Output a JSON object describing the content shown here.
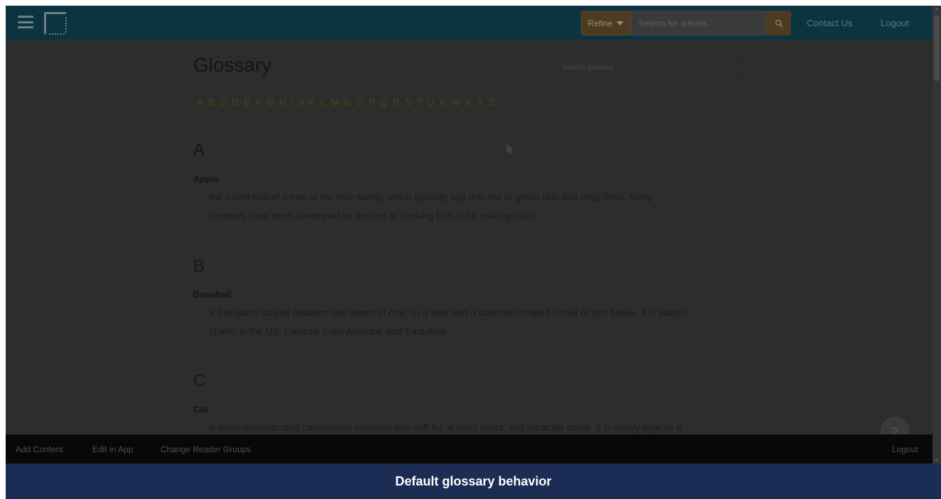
{
  "topnav": {
    "refine_label": "Refine",
    "search_placeholder": "Search for articles...",
    "contact_label": "Contact Us",
    "logout_label": "Logout"
  },
  "page": {
    "title": "Glossary",
    "search_placeholder": "Search glossary",
    "alphabet": [
      "A",
      "B",
      "C",
      "D",
      "E",
      "F",
      "G",
      "H",
      "I",
      "J",
      "K",
      "L",
      "M",
      "N",
      "O",
      "P",
      "Q",
      "R",
      "S",
      "T",
      "U",
      "V",
      "W",
      "X",
      "Y",
      "Z"
    ]
  },
  "sections": [
    {
      "letter": "A",
      "term": "Apple",
      "definition_line1": "the round fruit of a tree of the rose family, which typically has thin red or green skin and crisp flesh. Many",
      "definition_line2": "varieties have been developed as dessert or cooking fruit or for making cider."
    },
    {
      "letter": "B",
      "term": "Baseball",
      "definition_line1": "a ball game played between two teams of nine on a field with a diamond-shaped circuit of four bases. It is played",
      "definition_line2": "chiefly in the US, Canada, Latin America, and East Asia."
    },
    {
      "letter": "C",
      "term": "Cat",
      "definition_line1": "a small domesticated carnivorous mammal with soft fur, a short snout, and retractile claws. It is widely kept as a"
    }
  ],
  "help": {
    "label": "?"
  },
  "bottombar": {
    "add_content": "Add Content",
    "edit_in_app": "Edit in App",
    "change_reader_groups": "Change Reader Groups",
    "logout": "Logout"
  },
  "caption": "Default glossary behavior",
  "colors": {
    "nav_bg": "#0b3440",
    "accent": "#4d3a22",
    "caption_bg": "#1b2d55",
    "overlay": "#2d2d2d"
  }
}
